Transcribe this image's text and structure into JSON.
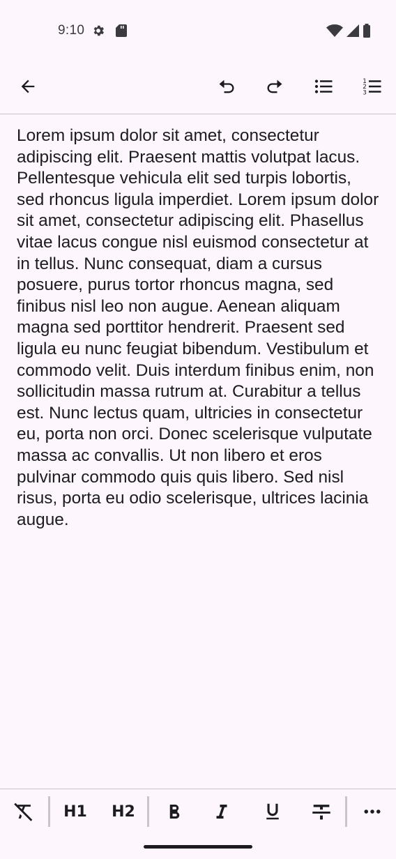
{
  "status_bar": {
    "time": "9:10",
    "icons": [
      "settings-icon",
      "sd-card-icon",
      "wifi-icon",
      "signal-icon",
      "battery-icon"
    ]
  },
  "toolbar": {
    "buttons": [
      "back-arrow-icon",
      "undo-icon",
      "redo-icon",
      "bulleted-list-icon",
      "numbered-list-icon"
    ]
  },
  "editor": {
    "text": "Lorem ipsum dolor sit amet, consectetur adipiscing elit. Praesent mattis volutpat lacus. Pellentesque vehicula elit sed turpis lobortis, sed rhoncus ligula imperdiet. Lorem ipsum dolor sit amet, consectetur adipiscing elit. Phasellus vitae lacus congue nisl euismod consectetur at in tellus. Nunc consequat, diam a cursus posuere, purus tortor rhoncus magna, sed finibus nisl leo non augue. Aenean aliquam magna sed porttitor hendrerit. Praesent sed ligula eu nunc feugiat bibendum. Vestibulum et commodo velit. Duis interdum finibus enim, non sollicitudin massa rutrum at. Curabitur a tellus est. Nunc lectus quam, ultricies in consectetur eu, porta non orci. Donec scelerisque vulputate massa ac convallis. Ut non libero et eros pulvinar commodo quis quis libero. Sed nisl risus, porta eu odio scelerisque, ultrices lacinia augue."
  },
  "format_bar": {
    "h1_label": "H1",
    "h2_label": "H2",
    "icons": [
      "clear-format-icon",
      "bold-icon",
      "italic-icon",
      "underline-icon",
      "strikethrough-icon",
      "more-icon"
    ]
  },
  "colors": {
    "background": "#fdf7fd",
    "text": "#1c1b1f",
    "divider": "#c9c5ca"
  }
}
